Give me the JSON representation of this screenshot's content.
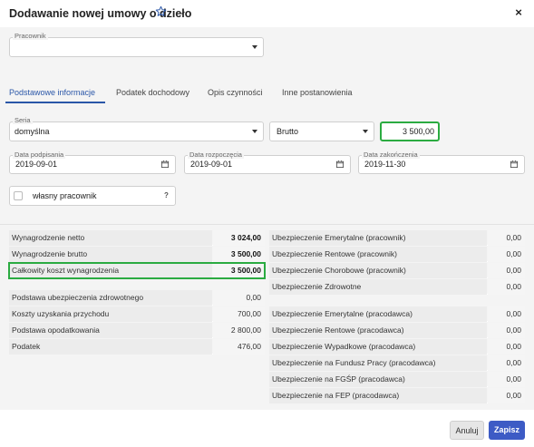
{
  "dialog": {
    "title": "Dodawanie nowej umowy o dzieło",
    "close": "×"
  },
  "employee": {
    "label": "Pracownik",
    "value": ""
  },
  "tabs": [
    {
      "label": "Podstawowe informacje",
      "active": true
    },
    {
      "label": "Podatek dochodowy",
      "active": false
    },
    {
      "label": "Opis czynności",
      "active": false
    },
    {
      "label": "Inne postanowienia",
      "active": false
    }
  ],
  "form": {
    "seria": {
      "label": "Seria",
      "value": "domyślna"
    },
    "type": {
      "value": "Brutto"
    },
    "amount": {
      "value": "3 500,00"
    },
    "date_sign": {
      "label": "Data podpisania",
      "value": "2019-09-01"
    },
    "date_start": {
      "label": "Data rozpoczęcia",
      "value": "2019-09-01"
    },
    "date_end": {
      "label": "Data zakończenia",
      "value": "2019-11-30"
    },
    "own_employee": {
      "label": "własny pracownik",
      "help": "?",
      "checked": false
    }
  },
  "left_table_1": [
    {
      "label": "Wynagrodzenie netto",
      "value": "3 024,00"
    },
    {
      "label": "Wynagrodzenie brutto",
      "value": "3 500,00"
    },
    {
      "label": "Całkowity koszt wynagrodzenia",
      "value": "3 500,00"
    }
  ],
  "left_table_2": [
    {
      "label": "Podstawa ubezpieczenia zdrowotnego",
      "value": "0,00"
    },
    {
      "label": "Koszty uzyskania przychodu",
      "value": "700,00"
    },
    {
      "label": "Podstawa opodatkowania",
      "value": "2 800,00"
    },
    {
      "label": "Podatek",
      "value": "476,00"
    }
  ],
  "right_table_1": [
    {
      "label": "Ubezpieczenie Emerytalne (pracownik)",
      "value": "0,00"
    },
    {
      "label": "Ubezpieczenie Rentowe (pracownik)",
      "value": "0,00"
    },
    {
      "label": "Ubezpieczenie Chorobowe (pracownik)",
      "value": "0,00"
    },
    {
      "label": "Ubezpieczenie Zdrowotne",
      "value": "0,00"
    }
  ],
  "right_table_2": [
    {
      "label": "Ubezpieczenie Emerytalne (pracodawca)",
      "value": "0,00"
    },
    {
      "label": "Ubezpieczenie Rentowe (pracodawca)",
      "value": "0,00"
    },
    {
      "label": "Ubezpieczenie Wypadkowe (pracodawca)",
      "value": "0,00"
    },
    {
      "label": "Ubezpieczenie na Fundusz Pracy (pracodawca)",
      "value": "0,00"
    },
    {
      "label": "Ubezpieczenie na FGŚP (pracodawca)",
      "value": "0,00"
    },
    {
      "label": "Ubezpieczenie na FEP (pracodawca)",
      "value": "0,00"
    }
  ],
  "buttons": {
    "cancel": "Anuluj",
    "save": "Zapisz"
  },
  "colors": {
    "accent": "#2b57a8",
    "primary_button": "#3d5bc5",
    "highlight": "#2bab41"
  }
}
